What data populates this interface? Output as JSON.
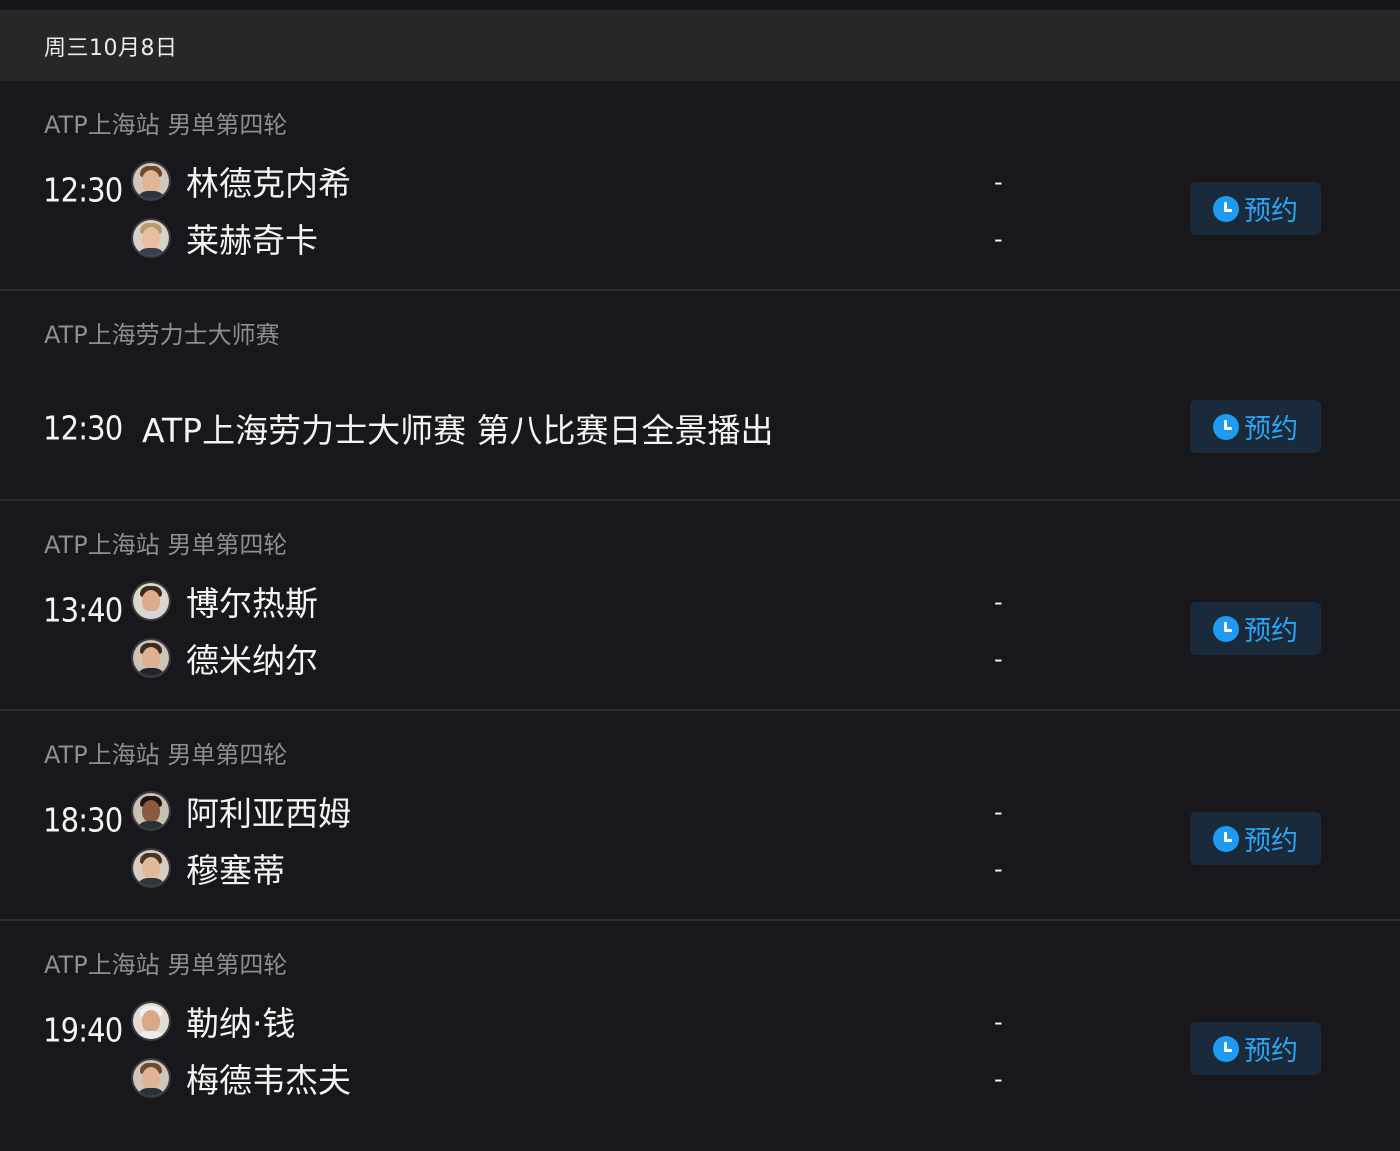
{
  "date_header": "周三10月8日",
  "reserve_label": "预约",
  "score_placeholder": "-",
  "colors": {
    "background": "#18181c",
    "header_background": "#27272a",
    "accent": "#1e9bf0",
    "button_background": "#1b2a3b"
  },
  "matches": [
    {
      "league": "ATP上海站 男单第四轮",
      "time": "12:30",
      "players": [
        {
          "name": "林德克内希",
          "avatar_icon": "player-avatar-icon"
        },
        {
          "name": "莱赫奇卡",
          "avatar_icon": "player-avatar-icon"
        }
      ],
      "scores": [
        "-",
        "-"
      ]
    },
    {
      "league": "ATP上海劳力士大师赛",
      "time": "12:30",
      "broadcast_title": "ATP上海劳力士大师赛 第八比赛日全景播出"
    },
    {
      "league": "ATP上海站 男单第四轮",
      "time": "13:40",
      "players": [
        {
          "name": "博尔热斯",
          "avatar_icon": "player-avatar-icon"
        },
        {
          "name": "德米纳尔",
          "avatar_icon": "player-avatar-icon"
        }
      ],
      "scores": [
        "-",
        "-"
      ]
    },
    {
      "league": "ATP上海站 男单第四轮",
      "time": "18:30",
      "players": [
        {
          "name": "阿利亚西姆",
          "avatar_icon": "player-avatar-icon"
        },
        {
          "name": "穆塞蒂",
          "avatar_icon": "player-avatar-icon"
        }
      ],
      "scores": [
        "-",
        "-"
      ]
    },
    {
      "league": "ATP上海站 男单第四轮",
      "time": "19:40",
      "players": [
        {
          "name": "勒纳·钱",
          "avatar_icon": "player-avatar-icon"
        },
        {
          "name": "梅德韦杰夫",
          "avatar_icon": "player-avatar-icon"
        }
      ],
      "scores": [
        "-",
        "-"
      ]
    }
  ]
}
